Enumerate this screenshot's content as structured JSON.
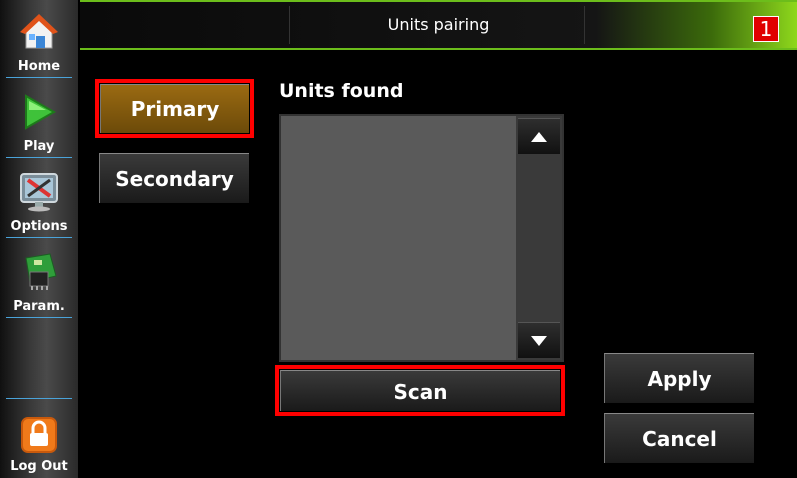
{
  "sidebar": {
    "items": [
      {
        "label": "Home",
        "icon": "home-icon"
      },
      {
        "label": "Play",
        "icon": "play-icon"
      },
      {
        "label": "Options",
        "icon": "options-icon"
      },
      {
        "label": "Param.",
        "icon": "param-icon"
      }
    ],
    "logout": {
      "label": "Log Out",
      "icon": "lock-icon"
    }
  },
  "header": {
    "title": "Units pairing",
    "badge": "1"
  },
  "tabs": {
    "primary": "Primary",
    "secondary": "Secondary"
  },
  "units": {
    "label": "Units found",
    "items": []
  },
  "actions": {
    "scan": "Scan",
    "apply": "Apply",
    "cancel": "Cancel"
  },
  "colors": {
    "accent_green": "#8ed81c",
    "highlight_red": "#ff0000",
    "primary_gold": "#9a6a12"
  }
}
